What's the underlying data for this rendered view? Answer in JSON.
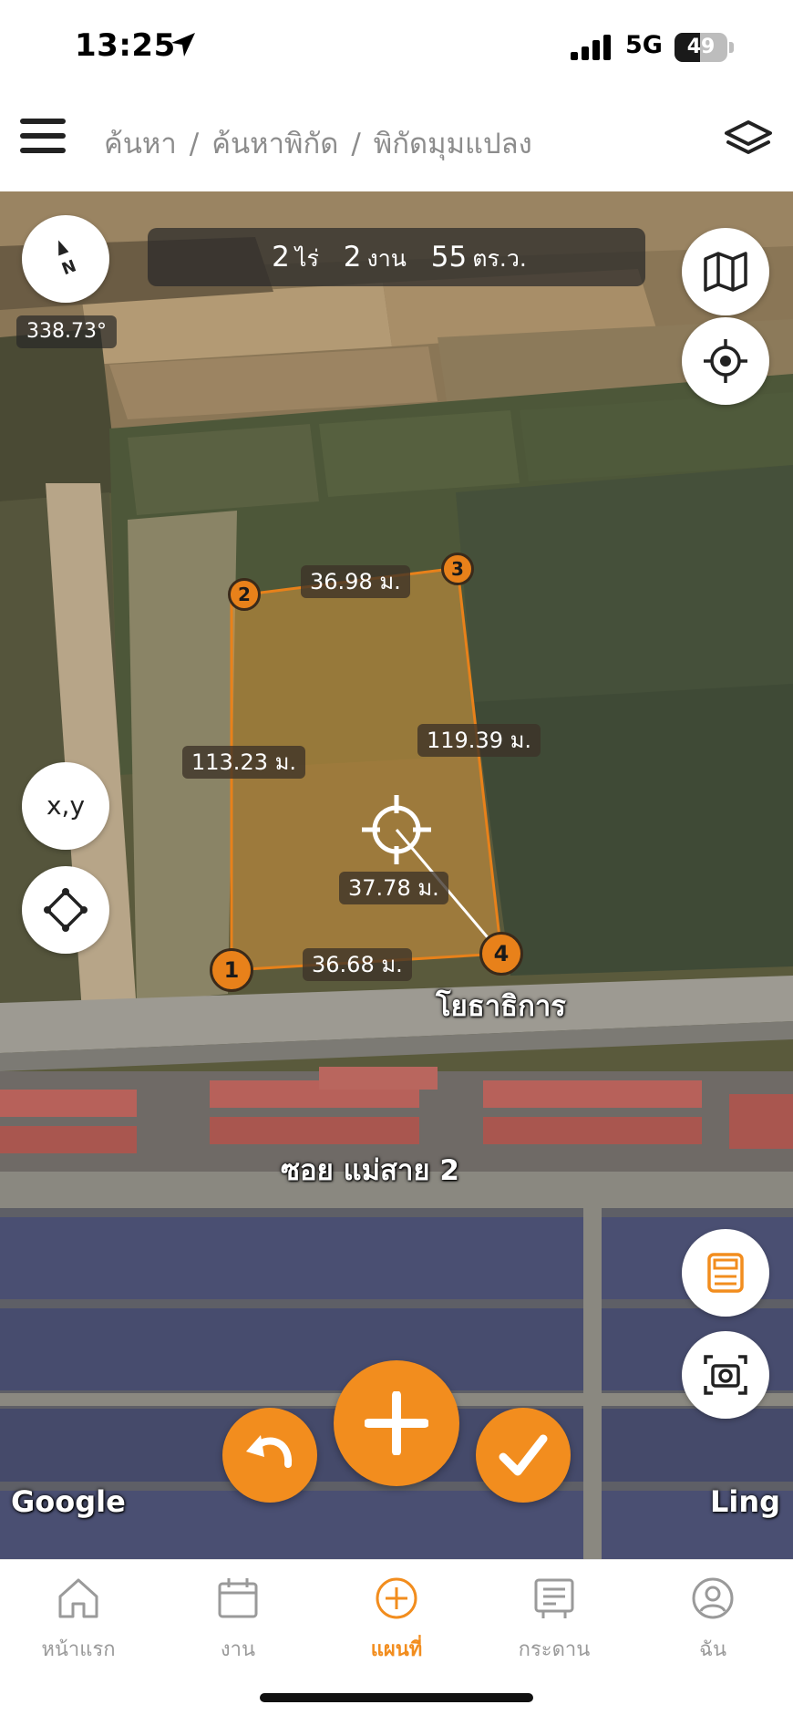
{
  "status_bar": {
    "time": "13:25",
    "network": "5G",
    "battery": "49",
    "battery_level": 0.49
  },
  "header": {
    "breadcrumb": [
      "ค้นหา",
      "ค้นหาพิกัด",
      "พิกัดมุมแปลง"
    ],
    "separator": "/",
    "menu_icon": "hamburger-icon",
    "layers_icon": "layers-icon"
  },
  "map": {
    "area": {
      "rai_value": "2",
      "rai_unit": "ไร่",
      "ngan_value": "2",
      "ngan_unit": "งาน",
      "wa_value": "55",
      "wa_unit": "ตร.ว."
    },
    "compass": {
      "north_label": "N",
      "heading": "338.73°"
    },
    "vertices": [
      "1",
      "2",
      "3",
      "4"
    ],
    "distances": {
      "top": "36.98 ม.",
      "left": "113.23 ม.",
      "right": "119.39 ม.",
      "bottom": "36.68 ม.",
      "cursor": "37.78 ม."
    },
    "xy_button": "x,y",
    "road_labels": [
      "โยธาธิการ",
      "ซอย แม่สาย 2"
    ],
    "attribution": "Google",
    "user_label": "Ling",
    "polygon_color": "#e8811a",
    "accent_color": "#f28d1e",
    "fab_icons": [
      "undo-icon",
      "plus-icon",
      "check-icon"
    ]
  },
  "bottom_nav": {
    "items": [
      {
        "label": "หน้าแรก",
        "icon": "home-icon"
      },
      {
        "label": "งาน",
        "icon": "calendar-icon"
      },
      {
        "label": "แผนที่",
        "icon": "plus-circle-icon",
        "active": true
      },
      {
        "label": "กระดาน",
        "icon": "board-icon"
      },
      {
        "label": "ฉัน",
        "icon": "user-icon"
      }
    ]
  }
}
